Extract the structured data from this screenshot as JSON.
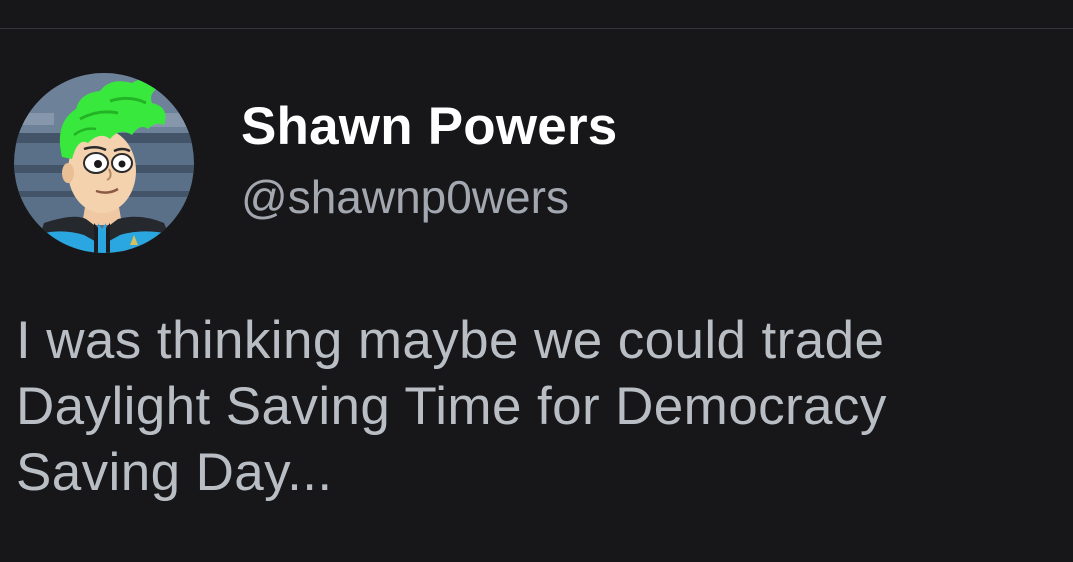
{
  "tweet": {
    "author": {
      "display_name": "Shawn Powers",
      "handle": "@shawnp0wers",
      "avatar_icon": "cartoon-avatar-green-hair"
    },
    "text_lines": [
      "I was thinking maybe we could trade",
      "Daylight Saving Time for Democracy",
      "Saving Day..."
    ]
  },
  "colors": {
    "background": "#17171a",
    "divider": "#34363b",
    "name": "#ffffff",
    "handle": "#a3a8b0",
    "body_text": "#b9bec5",
    "avatar_hair": "#39e83c",
    "avatar_uniform_accent": "#2aa7e0"
  }
}
